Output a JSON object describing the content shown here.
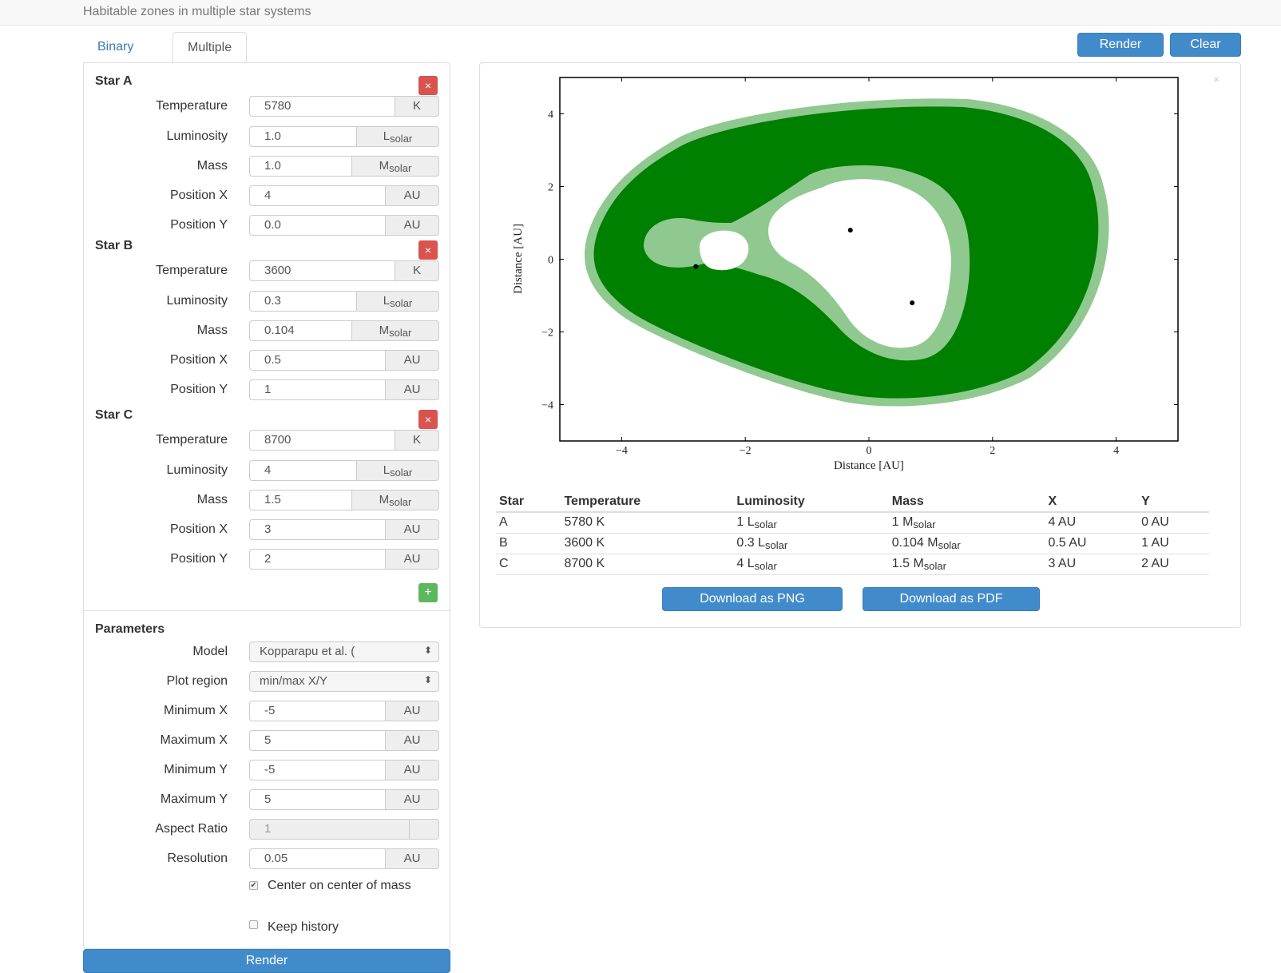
{
  "header": {
    "title": "Habitable zones in multiple star systems"
  },
  "tabs": {
    "binary": "Binary",
    "multiple": "Multiple"
  },
  "toolbar": {
    "render": "Render",
    "clear": "Clear"
  },
  "labels": {
    "temperature": "Temperature",
    "luminosity": "Luminosity",
    "mass": "Mass",
    "position_x": "Position X",
    "position_y": "Position Y",
    "unit_k": "K",
    "unit_l": "L",
    "unit_m": "M",
    "unit_sub": "solar",
    "unit_au": "AU",
    "remove": "×",
    "add": "+"
  },
  "stars": [
    {
      "title": "Star A",
      "temperature": "5780",
      "luminosity": "1.0",
      "mass": "1.0",
      "x": "4",
      "y": "0.0"
    },
    {
      "title": "Star B",
      "temperature": "3600",
      "luminosity": "0.3",
      "mass": "0.104",
      "x": "0.5",
      "y": "1"
    },
    {
      "title": "Star C",
      "temperature": "8700",
      "luminosity": "4",
      "mass": "1.5",
      "x": "3",
      "y": "2"
    }
  ],
  "parameters": {
    "title": "Parameters",
    "model_label": "Model",
    "model_value": "Kopparapu et al. (",
    "plot_region_label": "Plot region",
    "plot_region_value": "min/max X/Y",
    "min_x_label": "Minimum X",
    "min_x": "-5",
    "max_x_label": "Maximum X",
    "max_x": "5",
    "min_y_label": "Minimum Y",
    "min_y": "-5",
    "max_y_label": "Maximum Y",
    "max_y": "5",
    "aspect_label": "Aspect Ratio",
    "aspect": "1",
    "resolution_label": "Resolution",
    "resolution": "0.05",
    "center_label": "Center on center of mass",
    "center_checked": true,
    "history_label": "Keep history",
    "history_checked": false,
    "render": "Render"
  },
  "chart_data": {
    "type": "heatmap",
    "xlabel": "Distance [AU]",
    "ylabel": "Distance [AU]",
    "xlim": [
      -5,
      5
    ],
    "ylim": [
      -5,
      5
    ],
    "xticks": [
      "−4",
      "−2",
      "0",
      "2",
      "4"
    ],
    "yticks": [
      "4",
      "2",
      "0",
      "−2",
      "−4"
    ],
    "colors": {
      "dark_zone": "#008000",
      "light_zone": "#8fc98f",
      "background": "#ffffff",
      "star": "#000000"
    },
    "star_markers": [
      {
        "x": -2.8,
        "y": -0.2
      },
      {
        "x": -0.3,
        "y": 0.8
      },
      {
        "x": 0.7,
        "y": -1.2
      }
    ]
  },
  "table": {
    "headers": [
      "Star",
      "Temperature",
      "Luminosity",
      "Mass",
      "X",
      "Y"
    ],
    "rows": [
      {
        "star": "A",
        "temp": "5780 K",
        "lum": "1 L",
        "mass": "1 M",
        "x": "4 AU",
        "y": "0 AU"
      },
      {
        "star": "B",
        "temp": "3600 K",
        "lum": "0.3 L",
        "mass": "0.104 M",
        "x": "0.5 AU",
        "y": "1 AU"
      },
      {
        "star": "C",
        "temp": "8700 K",
        "lum": "4 L",
        "mass": "1.5 M",
        "x": "3 AU",
        "y": "2 AU"
      }
    ]
  },
  "downloads": {
    "png": "Download as PNG",
    "pdf": "Download as PDF"
  },
  "plot_close": "×"
}
